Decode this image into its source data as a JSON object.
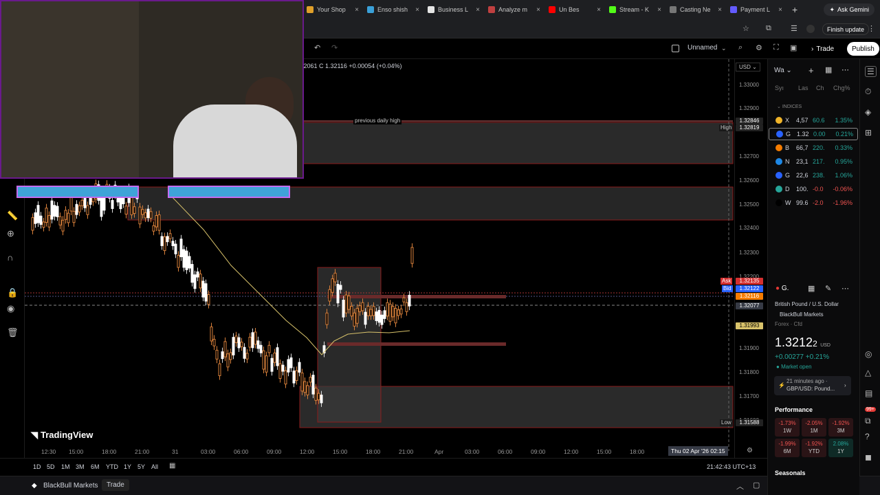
{
  "browser": {
    "tabs": [
      {
        "label": "Your Shop",
        "color": "#e0a02a"
      },
      {
        "label": "Enso shish",
        "color": "#3aa0d8"
      },
      {
        "label": "Business L",
        "color": "#e5e5e5"
      },
      {
        "label": "Analyze m",
        "color": "#c04040"
      },
      {
        "label": "Un Bes",
        "color": "#ff0000"
      },
      {
        "label": "Stream - K",
        "color": "#53fc18"
      },
      {
        "label": "Casting Ne",
        "color": "#777777"
      },
      {
        "label": "Payment L",
        "color": "#635bff"
      }
    ],
    "ask_gemini": "Ask Gemini",
    "finish_update": "Finish update"
  },
  "toolbar": {
    "layout_name": "Unnamed",
    "trade": "Trade",
    "publish": "Publish"
  },
  "chart": {
    "ohlc": "1.32061  C 1.32116  +0.00054 (+0.04%)",
    "currency": "USD",
    "annotation": "previous daily high",
    "price_ticks": [
      "1.33000",
      "1.32900",
      "1.32700",
      "1.32600",
      "1.32500",
      "1.32400",
      "1.32300",
      "1.32200",
      "1.31900",
      "1.31800",
      "1.31700",
      "1.31600"
    ],
    "labels": {
      "high_tag": "High",
      "high_price": "1.32846",
      "high_price2": "1.32819",
      "ask_tag": "Ask",
      "ask": "1.32135",
      "bid_tag": "Bid",
      "bid": "1.32122",
      "last": "1.32116",
      "crosshair": "1.32077",
      "ma": "1.31993",
      "low_tag": "Low",
      "low": "1.31588"
    },
    "time_labels": [
      "12:30",
      "15:00",
      "18:00",
      "21:00",
      "31",
      "03:00",
      "06:00",
      "09:00",
      "12:00",
      "15:00",
      "18:00",
      "21:00",
      "Apr",
      "03:00",
      "06:00",
      "09:00",
      "12:00",
      "15:00",
      "18:00"
    ],
    "cursor_time": "Thu 02 Apr '26  02:15",
    "logo": "TradingView",
    "ranges": [
      "1D",
      "5D",
      "1M",
      "3M",
      "6M",
      "YTD",
      "1Y",
      "5Y",
      "All"
    ],
    "clock": "21:42:43 UTC+13"
  },
  "footer": {
    "broker": "BlackBull Markets",
    "trade": "Trade"
  },
  "watchlist": {
    "title": "Wa",
    "cols": [
      "Syı",
      "Las",
      "Ch",
      "Chg%"
    ],
    "section": "INDICES",
    "rows": [
      {
        "s": "X",
        "l": "4,57",
        "c": "60.6",
        "p": "1.35%",
        "dir": "up",
        "col": "#f0b429"
      },
      {
        "s": "G",
        "l": "1.32",
        "c": "0.00",
        "p": "0.21%",
        "dir": "up",
        "col": "#2962ff"
      },
      {
        "s": "B",
        "l": "66,7",
        "c": "220.",
        "p": "0.33%",
        "dir": "up",
        "col": "#f57c00"
      },
      {
        "s": "N",
        "l": "23,1",
        "c": "217.",
        "p": "0.95%",
        "dir": "up",
        "col": "#1e88e5"
      },
      {
        "s": "G",
        "l": "22,6",
        "c": "238.",
        "p": "1.06%",
        "dir": "up",
        "col": "#2962ff"
      },
      {
        "s": "D",
        "l": "100.",
        "c": "-0.0",
        "p": "-0.06%",
        "dir": "down",
        "col": "#26a69a"
      },
      {
        "s": "W",
        "l": "99.6",
        "c": "-2.0",
        "p": "-1.96%",
        "dir": "down",
        "col": "#000000"
      }
    ]
  },
  "details": {
    "symbol": "G.",
    "name": "British Pound / U.S. Dollar",
    "broker": "BlackBull Markets",
    "type": "Forex · Cfd",
    "price_main": "1.3212",
    "price_small": "2",
    "currency": "USD",
    "change": "+0.00277",
    "change_pct": "+0.21%",
    "status": "Market open",
    "news_time": "21 minutes ago ·",
    "news_text": "GBP/USD: Pound...",
    "performance_title": "Performance",
    "perf": [
      {
        "v": "-1.73%",
        "l": "1W",
        "dir": "down"
      },
      {
        "v": "-2.05%",
        "l": "1M",
        "dir": "down"
      },
      {
        "v": "-1.92%",
        "l": "3M",
        "dir": "down"
      },
      {
        "v": "-1.99%",
        "l": "6M",
        "dir": "down"
      },
      {
        "v": "-1.92%",
        "l": "YTD",
        "dir": "down"
      },
      {
        "v": "2.08%",
        "l": "1Y",
        "dir": "up"
      }
    ],
    "seasonals": "Seasonals",
    "badge": "99+"
  }
}
